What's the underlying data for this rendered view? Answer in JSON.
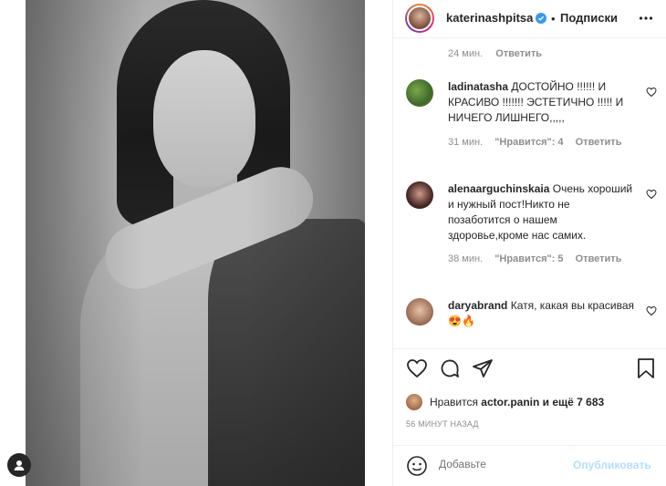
{
  "header": {
    "username": "katerinashpitsa",
    "dot": "•",
    "follow_label": "Подписки"
  },
  "comments": {
    "first_meta": {
      "time": "24 мин.",
      "reply": "Ответить"
    },
    "items": [
      {
        "username": "ladinatasha",
        "text": "ДОСТОЙНО !!!!!! И КРАСИВО !!!!!!! ЭСТЕТИЧНО !!!!! И НИЧЕГО ЛИШНЕГО,,,,,",
        "time": "31 мин.",
        "likes": "\"Нравится\": 4",
        "reply": "Ответить"
      },
      {
        "username": "alenaarguchinskaia",
        "text": "Очень хороший и нужный пост!Никто не позаботится о нашем здоровье,кроме нас самих.",
        "time": "38 мин.",
        "likes": "\"Нравится\": 5",
        "reply": "Ответить"
      },
      {
        "username": "daryabrand",
        "text": "Катя, какая вы красивая😍🔥",
        "time": "",
        "likes": "",
        "reply": ""
      }
    ]
  },
  "likes": {
    "prefix": "Нравится",
    "user": "actor.panin",
    "suffix": "и ещё 7 683"
  },
  "timeago": "56 МИНУТ НАЗАД",
  "add_comment": {
    "placeholder": "Добавьте",
    "publish_label": "Опубликовать"
  },
  "colors": {
    "accent_blue": "#3897f0",
    "publish_disabled": "#b2dffc",
    "muted": "#8e8e8e"
  }
}
